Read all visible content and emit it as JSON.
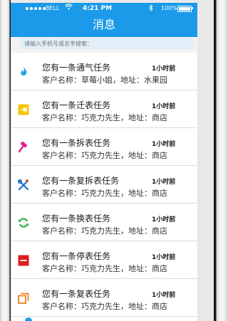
{
  "status_bar": {
    "carrier": "BELL",
    "time": "4:21 PM",
    "battery": "100%"
  },
  "header": {
    "title": "消息"
  },
  "search": {
    "placeholder": "请输入手机号或名字搜索："
  },
  "messages": [
    {
      "title": "您有一条通气任务",
      "time": "1小时前",
      "subtitle": "客户名称：草莓小姐，地址：水果园",
      "icon": "gas-flame-icon",
      "color": "#1aa0e8"
    },
    {
      "title": "您有一条迁表任务",
      "time": "1小时前",
      "subtitle": "客户名称：巧克力先生，地址：商店",
      "icon": "move-meter-icon",
      "color": "#f5c400"
    },
    {
      "title": "您有一条拆表任务",
      "time": "1小时前",
      "subtitle": "客户名称：巧克力先生，地址：商店",
      "icon": "hammer-icon",
      "color": "#e0238a"
    },
    {
      "title": "您有一条复拆表任务",
      "time": "1小时前",
      "subtitle": "客户名称：巧克力先生，地址：商店",
      "icon": "tools-icon",
      "color": "#1e6fd0"
    },
    {
      "title": "您有一条换表任务",
      "time": "1小时前",
      "subtitle": "客户名称：巧克力先生，地址：商店",
      "icon": "refresh-icon",
      "color": "#2bb24c"
    },
    {
      "title": "您有一条停表任务",
      "time": "1小时前",
      "subtitle": "客户名称：巧克力先生，地址：商店",
      "icon": "stop-icon",
      "color": "#e01c1c"
    },
    {
      "title": "您有一条复表任务",
      "time": "1小时前",
      "subtitle": "客户名称：巧克力先生，地址：商店",
      "icon": "copy-icon",
      "color": "#e8821a"
    }
  ]
}
